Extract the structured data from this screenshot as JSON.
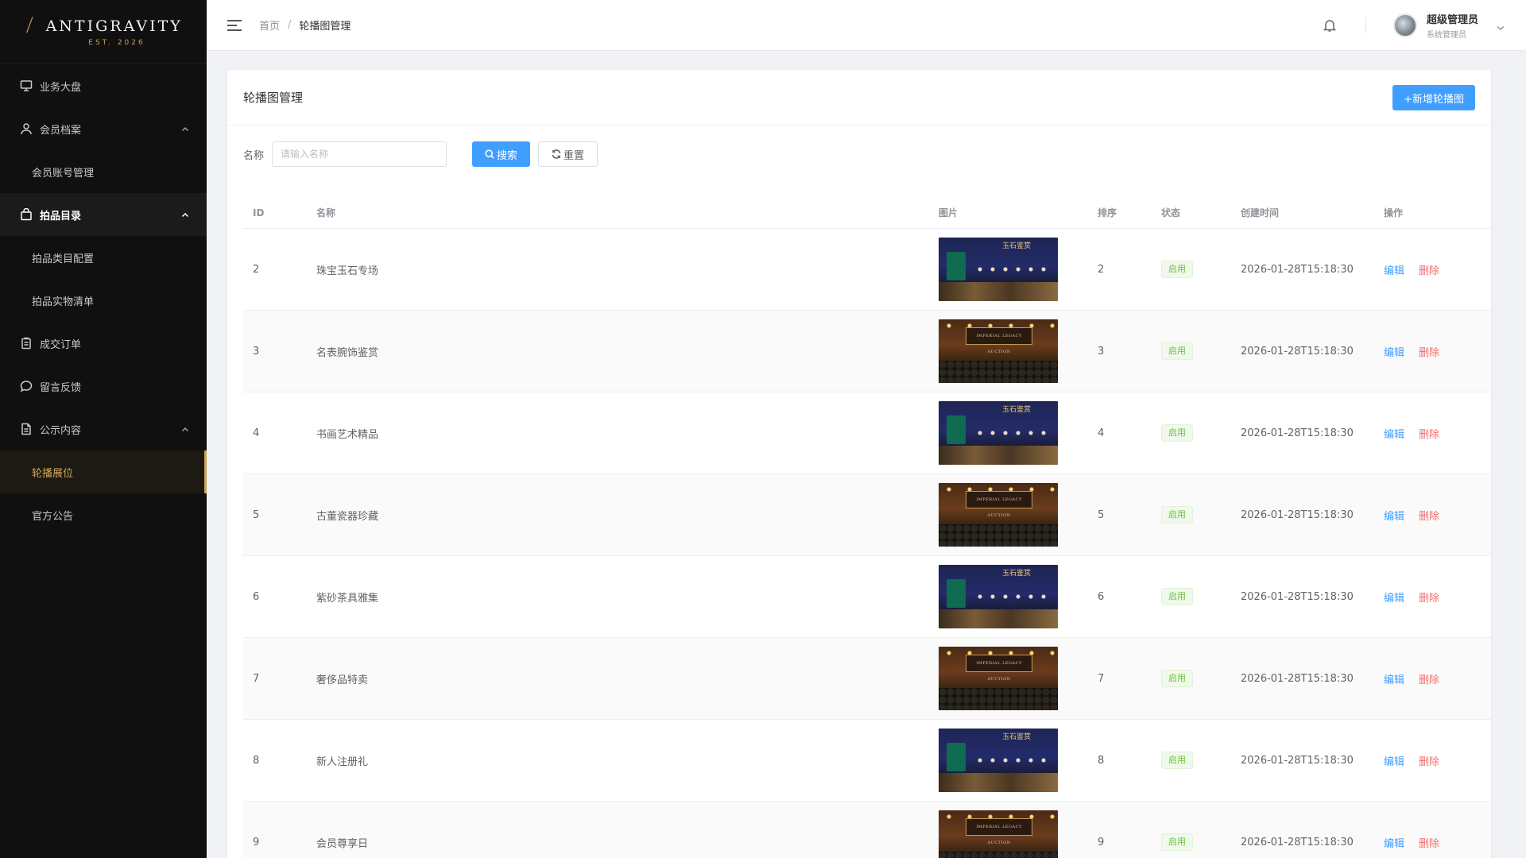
{
  "brand": {
    "name": "ANTIGRAVITY",
    "tagline": "EST. 2026",
    "mark": "⟋"
  },
  "sidebar": {
    "items": [
      {
        "label": "业务大盘",
        "icon": "monitor-icon"
      },
      {
        "label": "会员档案",
        "icon": "user-icon"
      },
      {
        "label": "会员账号管理"
      },
      {
        "label": "拍品目录",
        "icon": "bag-icon"
      },
      {
        "label": "拍品类目配置"
      },
      {
        "label": "拍品实物清单"
      },
      {
        "label": "成交订单",
        "icon": "clipboard-icon"
      },
      {
        "label": "留言反馈",
        "icon": "chat-icon"
      },
      {
        "label": "公示内容",
        "icon": "document-icon"
      },
      {
        "label": "轮播展位"
      },
      {
        "label": "官方公告"
      }
    ]
  },
  "header": {
    "breadcrumb_home": "首页",
    "breadcrumb_sep": "/",
    "breadcrumb_current": "轮播图管理",
    "user_name": "超级管理员",
    "user_role": "系统管理员"
  },
  "page": {
    "title": "轮播图管理",
    "add_button": "+新增轮播图",
    "search_label": "名称",
    "search_placeholder": "请输入名称",
    "search_button": "搜索",
    "reset_button": "重置"
  },
  "table": {
    "columns": [
      "ID",
      "名称",
      "图片",
      "排序",
      "状态",
      "创建时间",
      "操作"
    ],
    "rows": [
      {
        "id": "2",
        "name": "珠宝玉石专场",
        "sort": "2",
        "status": "启用",
        "created": "2026-01-28T15:18:30",
        "thumb": "blue",
        "edit": "编辑",
        "delete": "删除"
      },
      {
        "id": "3",
        "name": "名表腕饰鉴赏",
        "sort": "3",
        "status": "启用",
        "created": "2026-01-28T15:18:30",
        "thumb": "brown",
        "edit": "编辑",
        "delete": "删除"
      },
      {
        "id": "4",
        "name": "书画艺术精品",
        "sort": "4",
        "status": "启用",
        "created": "2026-01-28T15:18:30",
        "thumb": "blue",
        "edit": "编辑",
        "delete": "删除"
      },
      {
        "id": "5",
        "name": "古董瓷器珍藏",
        "sort": "5",
        "status": "启用",
        "created": "2026-01-28T15:18:30",
        "thumb": "brown",
        "edit": "编辑",
        "delete": "删除"
      },
      {
        "id": "6",
        "name": "紫砂茶具雅集",
        "sort": "6",
        "status": "启用",
        "created": "2026-01-28T15:18:30",
        "thumb": "blue",
        "edit": "编辑",
        "delete": "删除"
      },
      {
        "id": "7",
        "name": "奢侈品特卖",
        "sort": "7",
        "status": "启用",
        "created": "2026-01-28T15:18:30",
        "thumb": "brown",
        "edit": "编辑",
        "delete": "删除"
      },
      {
        "id": "8",
        "name": "新人注册礼",
        "sort": "8",
        "status": "启用",
        "created": "2026-01-28T15:18:30",
        "thumb": "blue",
        "edit": "编辑",
        "delete": "删除"
      },
      {
        "id": "9",
        "name": "会员尊享日",
        "sort": "9",
        "status": "启用",
        "created": "2026-01-28T15:18:30",
        "thumb": "brown",
        "edit": "编辑",
        "delete": "删除"
      }
    ]
  },
  "thumbs": {
    "blue_title": "玉石鉴赏",
    "brown_banner": "IMPERIAL LEGACY AUCTION"
  },
  "colors": {
    "accent": "#409eff",
    "brand_gold": "#c9a15a",
    "sidebar_bg": "#101010",
    "danger": "#f56c6c",
    "success": "#67c23a"
  }
}
